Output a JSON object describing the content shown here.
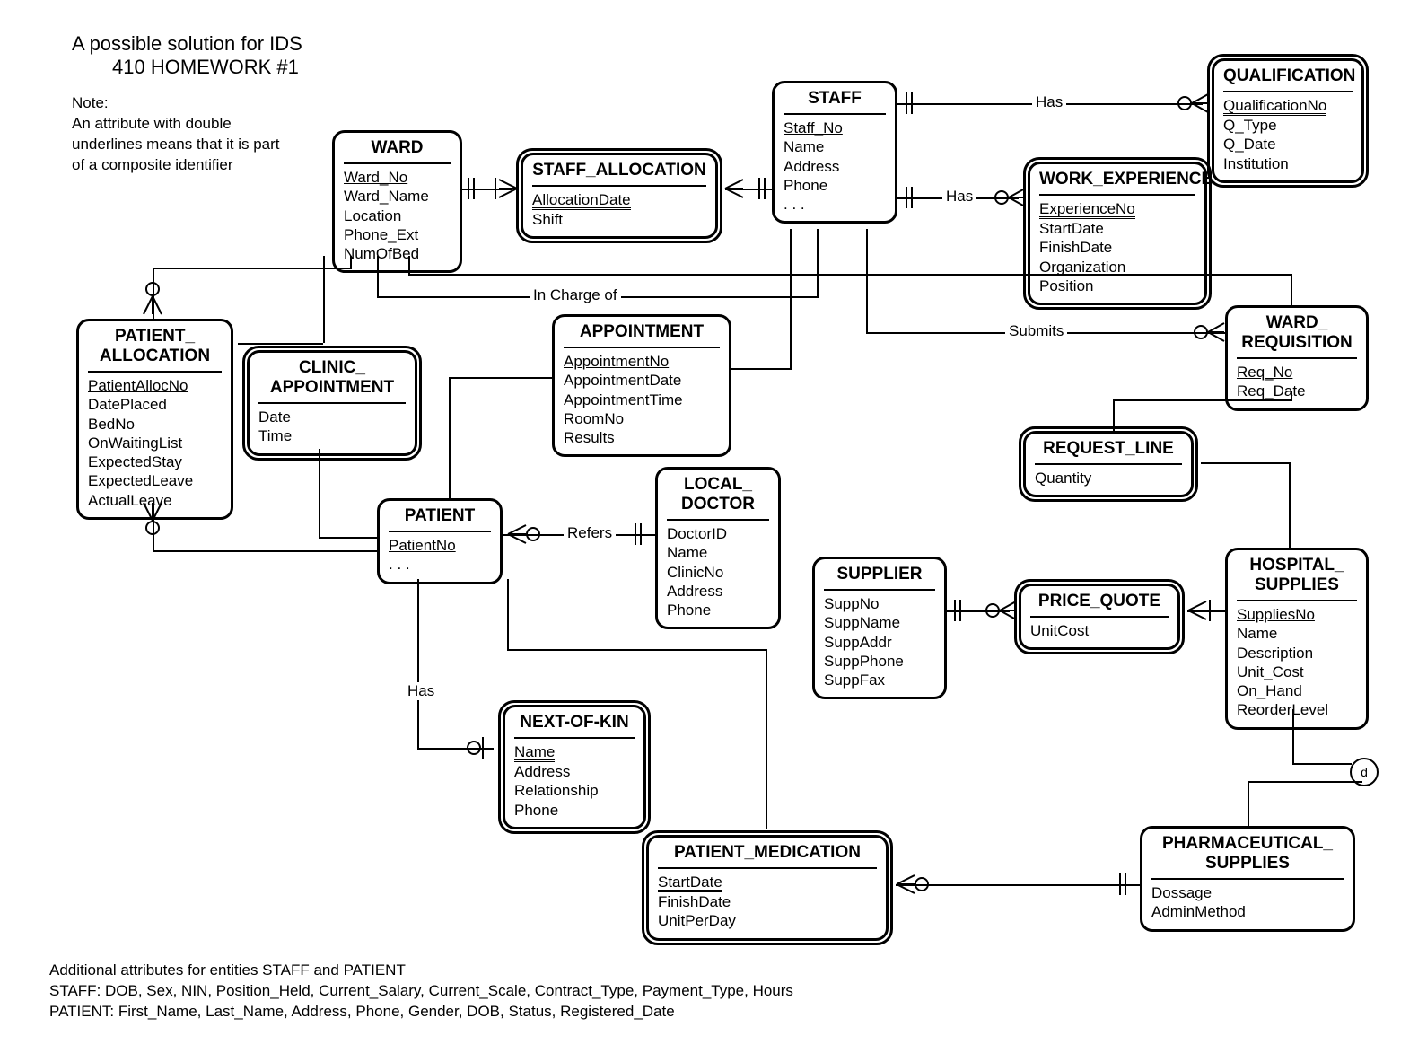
{
  "titles": {
    "line1": "A possible solution for IDS",
    "line2": "410 HOMEWORK #1"
  },
  "note": {
    "l1": "Note:",
    "l2": "An attribute with double",
    "l3": "underlines  means that it is part",
    "l4": "of a composite identifier"
  },
  "footer": {
    "l1": "Additional attributes for entities STAFF and PATIENT",
    "l2": "STAFF: DOB, Sex, NIN, Position_Held, Current_Salary, Current_Scale, Contract_Type, Payment_Type, Hours",
    "l3": "PATIENT: First_Name, Last_Name, Address, Phone, Gender, DOB, Status, Registered_Date"
  },
  "entities": {
    "ward": {
      "name": "WARD",
      "attrs": [
        "Ward_No",
        "Ward_Name",
        "Location",
        "Phone_Ext",
        "NumOfBed"
      ],
      "pk": [
        "Ward_No"
      ]
    },
    "staff_allocation": {
      "name": "STAFF_ALLOCATION",
      "attrs": [
        "AllocationDate",
        "Shift"
      ],
      "dpk": [
        "AllocationDate"
      ],
      "weak": true
    },
    "staff": {
      "name": "STAFF",
      "attrs": [
        "Staff_No",
        "Name",
        "Address",
        "Phone",
        ". . ."
      ],
      "pk": [
        "Staff_No"
      ]
    },
    "qualification": {
      "name": "QUALIFICATION",
      "attrs": [
        "QualificationNo",
        "Q_Type",
        "Q_Date",
        "Institution"
      ],
      "dpk": [
        "QualificationNo"
      ],
      "weak": true
    },
    "work_experience": {
      "name": "WORK_EXPERIENCE",
      "attrs": [
        "ExperienceNo",
        "StartDate",
        "FinishDate",
        "Organization",
        "Position"
      ],
      "dpk": [
        "ExperienceNo"
      ],
      "weak": true
    },
    "patient_allocation": {
      "name": "PATIENT_\nALLOCATION",
      "attrs": [
        "PatientAllocNo",
        "DatePlaced",
        "BedNo",
        "OnWaitingList",
        "ExpectedStay",
        "ExpectedLeave",
        "ActualLeave"
      ],
      "pk": [
        "PatientAllocNo"
      ]
    },
    "clinic_appointment": {
      "name": "CLINIC_\nAPPOINTMENT",
      "attrs": [
        "Date",
        "Time"
      ],
      "weak": true
    },
    "appointment": {
      "name": "APPOINTMENT",
      "attrs": [
        "AppointmentNo",
        "AppointmentDate",
        "AppointmentTime",
        "RoomNo",
        "Results"
      ],
      "pk": [
        "AppointmentNo"
      ]
    },
    "ward_requisition": {
      "name": "WARD_\nREQUISITION",
      "attrs": [
        "Req_No",
        "Req_Date"
      ],
      "pk": [
        "Req_No"
      ]
    },
    "request_line": {
      "name": "REQUEST_LINE",
      "attrs": [
        "Quantity"
      ],
      "weak": true
    },
    "patient": {
      "name": "PATIENT",
      "attrs": [
        "PatientNo",
        ". . ."
      ],
      "pk": [
        "PatientNo"
      ]
    },
    "local_doctor": {
      "name": "LOCAL_\nDOCTOR",
      "attrs": [
        "DoctorID",
        "Name",
        "ClinicNo",
        "Address",
        "Phone"
      ],
      "pk": [
        "DoctorID"
      ]
    },
    "supplier": {
      "name": "SUPPLIER",
      "attrs": [
        "SuppNo",
        "SuppName",
        "SuppAddr",
        "SuppPhone",
        "SuppFax"
      ],
      "pk": [
        "SuppNo"
      ]
    },
    "price_quote": {
      "name": "PRICE_QUOTE",
      "attrs": [
        "UnitCost"
      ],
      "weak": true
    },
    "hospital_supplies": {
      "name": "HOSPITAL_\nSUPPLIES",
      "attrs": [
        "SuppliesNo",
        "Name",
        "Description",
        "Unit_Cost",
        "On_Hand",
        "ReorderLevel"
      ],
      "pk": [
        "SuppliesNo"
      ]
    },
    "next_of_kin": {
      "name": "NEXT-OF-KIN",
      "attrs": [
        "Name",
        "Address",
        "Relationship",
        "Phone"
      ],
      "dpk": [
        "Name"
      ],
      "weak": true
    },
    "patient_medication": {
      "name": "PATIENT_MEDICATION",
      "attrs": [
        "StartDate",
        "FinishDate",
        "UnitPerDay"
      ],
      "dpk": [
        "StartDate"
      ],
      "weak": true
    },
    "pharmaceutical_supplies": {
      "name": "PHARMACEUTICAL_\nSUPPLIES",
      "attrs": [
        "Dossage",
        "AdminMethod"
      ]
    }
  },
  "relationships": {
    "has_qual": "Has",
    "has_exp": "Has",
    "in_charge": "In Charge of",
    "submits": "Submits",
    "refers": "Refers",
    "has_nok": "Has"
  },
  "misc": {
    "d_label": "d"
  }
}
